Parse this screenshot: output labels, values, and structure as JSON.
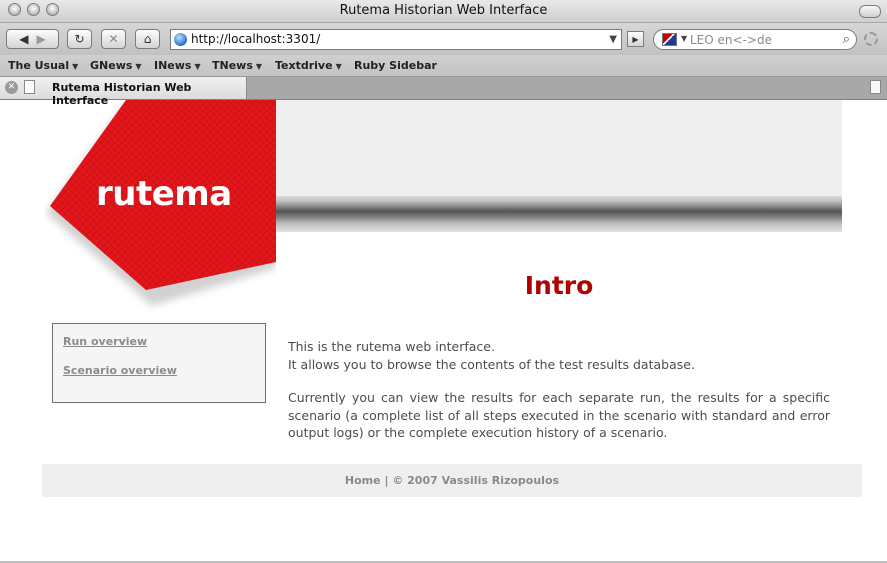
{
  "window": {
    "title": "Rutema Historian Web Interface"
  },
  "toolbar": {
    "url": "http://localhost:3301/",
    "search_placeholder": "LEO en<->de"
  },
  "bookmarks": [
    {
      "label": "The Usual",
      "has_menu": true
    },
    {
      "label": "GNews",
      "has_menu": true
    },
    {
      "label": "INews",
      "has_menu": true
    },
    {
      "label": "TNews",
      "has_menu": true
    },
    {
      "label": "Textdrive",
      "has_menu": true
    },
    {
      "label": "Ruby Sidebar",
      "has_menu": false
    }
  ],
  "tab": {
    "label": "Rutema Historian Web Interface"
  },
  "page": {
    "logo": "rutema",
    "heading": "Intro",
    "sidebar": [
      {
        "label": "Run overview"
      },
      {
        "label": "Scenario overview"
      }
    ],
    "content": {
      "line1": "This is the rutema web interface.",
      "line2": "It allows you to browse the contents of the test results database.",
      "paragraph": "Currently you can view the results for each separate run, the results for a specific scenario (a complete list of all steps executed in the scenario with standard and error output logs) or the complete execution history of a scenario."
    },
    "footer": {
      "home": "Home",
      "separator": "|",
      "copyright": "© 2007 Vassilis Rizopoulos"
    }
  },
  "colors": {
    "logo_red": "#e3161b",
    "heading_red": "#b10000",
    "link_grey": "#8c8c8c"
  }
}
